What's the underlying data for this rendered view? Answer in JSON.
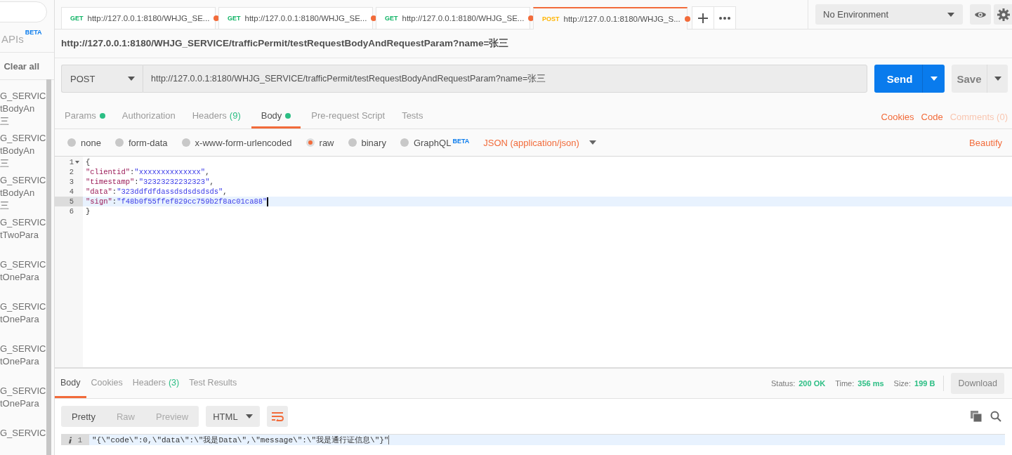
{
  "sidebar": {
    "apis_label": "APIs",
    "apis_badge": "BETA",
    "clear_all": "Clear all",
    "history": [
      {
        "lines": [
          "G_SERVIC",
          "tBodyAn",
          "三"
        ]
      },
      {
        "lines": [
          "G_SERVIC",
          "tBodyAn",
          "三"
        ]
      },
      {
        "lines": [
          "G_SERVIC",
          "tBodyAn",
          "三"
        ]
      },
      {
        "lines": [
          "G_SERVIC",
          "tTwoPara"
        ]
      },
      {
        "lines": [
          "G_SERVIC",
          "tOnePara"
        ]
      },
      {
        "lines": [
          "G_SERVIC",
          "tOnePara"
        ]
      },
      {
        "lines": [
          "G_SERVIC",
          "tOnePara"
        ]
      },
      {
        "lines": [
          "G_SERVIC",
          "tOnePara"
        ]
      },
      {
        "lines": [
          "G_SERVIC"
        ]
      }
    ]
  },
  "tabs": [
    {
      "method": "GET",
      "title": "http://127.0.0.1:8180/WHJG_SE...",
      "modified": true,
      "selected": false
    },
    {
      "method": "GET",
      "title": "http://127.0.0.1:8180/WHJG_SE...",
      "modified": true,
      "selected": false
    },
    {
      "method": "GET",
      "title": "http://127.0.0.1:8180/WHJG_SE...",
      "modified": true,
      "selected": false
    },
    {
      "method": "POST",
      "title": "http://127.0.0.1:8180/WHJG_S...",
      "modified": true,
      "selected": true
    }
  ],
  "environment": "No Environment",
  "request": {
    "title": "http://127.0.0.1:8180/WHJG_SERVICE/trafficPermit/testRequestBodyAndRequestParam?name=张三",
    "method": "POST",
    "url": "http://127.0.0.1:8180/WHJG_SERVICE/trafficPermit/testRequestBodyAndRequestParam?name=张三",
    "send": "Send",
    "save": "Save"
  },
  "request_tabs": [
    {
      "label": "Params",
      "dot": true,
      "selected": false
    },
    {
      "label": "Authorization",
      "dot": false,
      "selected": false
    },
    {
      "label": "Headers",
      "count": "(9)",
      "dot": false,
      "selected": false
    },
    {
      "label": "Body",
      "dot": true,
      "selected": true
    },
    {
      "label": "Pre-request Script",
      "dot": false,
      "selected": false
    },
    {
      "label": "Tests",
      "dot": false,
      "selected": false
    }
  ],
  "request_links": [
    {
      "label": "Cookies",
      "disabled": false
    },
    {
      "label": "Code",
      "disabled": false
    },
    {
      "label": "Comments (0)",
      "disabled": true
    }
  ],
  "body_types": [
    {
      "label": "none",
      "selected": false
    },
    {
      "label": "form-data",
      "selected": false
    },
    {
      "label": "x-www-form-urlencoded",
      "selected": false
    },
    {
      "label": "raw",
      "selected": true
    },
    {
      "label": "binary",
      "selected": false
    },
    {
      "label": "GraphQL",
      "badge": "BETA",
      "selected": false
    }
  ],
  "content_type": "JSON (application/json)",
  "beautify": "Beautify",
  "editor_lines": [
    {
      "number": "1",
      "foldable": true,
      "active": false,
      "tokens": [
        {
          "kind": "punct",
          "text": "{"
        }
      ]
    },
    {
      "number": "2",
      "foldable": false,
      "active": false,
      "tokens": [
        {
          "kind": "key",
          "text": "\"clientid\""
        },
        {
          "kind": "punct",
          "text": ":"
        },
        {
          "kind": "string",
          "text": "\"xxxxxxxxxxxxxx\""
        },
        {
          "kind": "punct",
          "text": ","
        }
      ]
    },
    {
      "number": "3",
      "foldable": false,
      "active": false,
      "tokens": [
        {
          "kind": "key",
          "text": "\"timestamp\""
        },
        {
          "kind": "punct",
          "text": ":"
        },
        {
          "kind": "string",
          "text": "\"32323232232323\""
        },
        {
          "kind": "punct",
          "text": ","
        }
      ]
    },
    {
      "number": "4",
      "foldable": false,
      "active": false,
      "tokens": [
        {
          "kind": "key",
          "text": "\"data\""
        },
        {
          "kind": "punct",
          "text": ":"
        },
        {
          "kind": "string",
          "text": "\"323ddfdfdassdsdsdsdsds\""
        },
        {
          "kind": "punct",
          "text": ","
        }
      ]
    },
    {
      "number": "5",
      "foldable": false,
      "active": true,
      "tokens": [
        {
          "kind": "key",
          "text": "\"sign\""
        },
        {
          "kind": "punct",
          "text": ":"
        },
        {
          "kind": "string",
          "text": "\"f48b0f55ffef829cc759b2f8ac01ca88\""
        }
      ]
    },
    {
      "number": "6",
      "foldable": false,
      "active": false,
      "tokens": [
        {
          "kind": "punct",
          "text": "}"
        }
      ]
    }
  ],
  "response_tabs": [
    {
      "label": "Body",
      "selected": true
    },
    {
      "label": "Cookies",
      "selected": false
    },
    {
      "label": "Headers",
      "count": "(3)",
      "selected": false
    },
    {
      "label": "Test Results",
      "selected": false
    }
  ],
  "response_stats": [
    {
      "label": "Status:",
      "value": "200 OK"
    },
    {
      "label": "Time:",
      "value": "356 ms"
    },
    {
      "label": "Size:",
      "value": "199 B"
    }
  ],
  "download": "Download",
  "view_modes": [
    {
      "label": "Pretty",
      "selected": true
    },
    {
      "label": "Raw",
      "selected": false
    },
    {
      "label": "Preview",
      "selected": false
    }
  ],
  "response_format": "HTML",
  "response_lines": [
    {
      "number": "1",
      "active": true,
      "text": "\"{\\\"code\\\":0,\\\"data\\\":\\\"我是Data\\\",\\\"message\\\":\\\"我是通行证信息\\\"}\""
    }
  ]
}
